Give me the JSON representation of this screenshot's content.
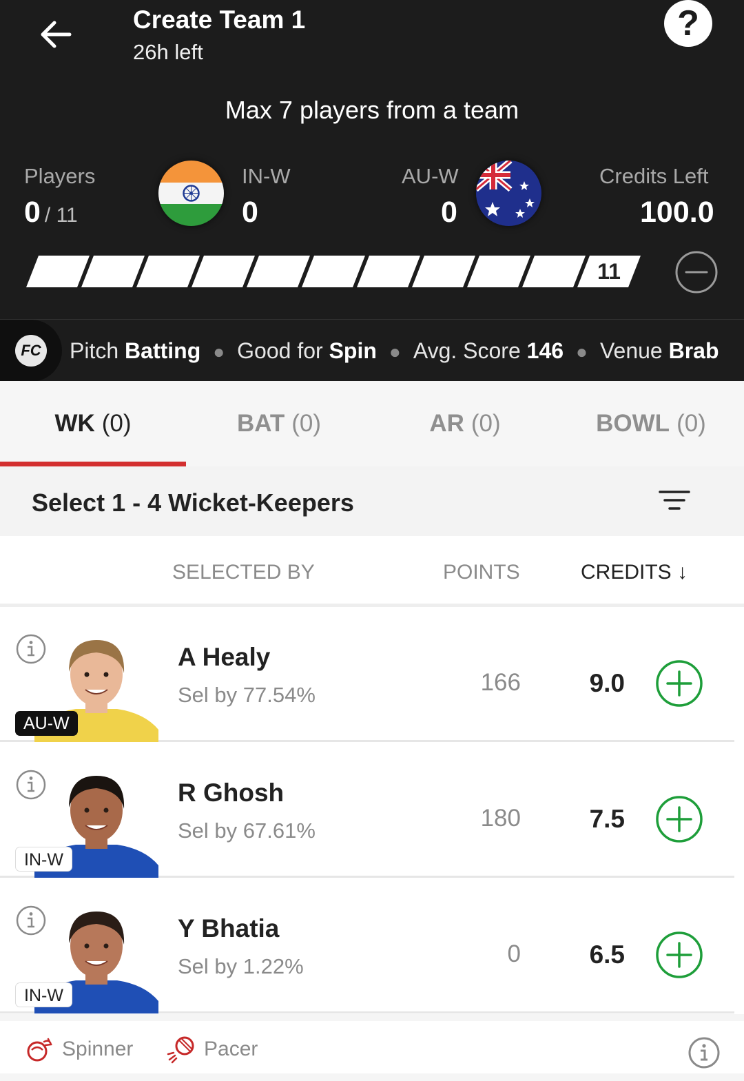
{
  "header": {
    "title": "Create Team 1",
    "time_left": "26h left",
    "help_label": "?",
    "max_note": "Max 7 players from a team"
  },
  "stats": {
    "players_label": "Players",
    "players_selected": "0",
    "players_total": "/ 11",
    "team1": {
      "code": "IN-W",
      "count": "0",
      "flag": "india-flag"
    },
    "team2": {
      "code": "AU-W",
      "count": "0",
      "flag": "australia-flag"
    },
    "credits_label": "Credits Left",
    "credits_value": "100.0"
  },
  "progress": {
    "filled": 0,
    "total_label": "11"
  },
  "pitch": {
    "logo": "FC",
    "items": [
      {
        "label": "Pitch",
        "value": "Batting"
      },
      {
        "label": "Good for",
        "value": "Spin"
      },
      {
        "label": "Avg. Score",
        "value": "146"
      },
      {
        "label": "Venue",
        "value": "Brab"
      }
    ]
  },
  "tabs": [
    {
      "label": "WK",
      "count": "(0)",
      "active": true
    },
    {
      "label": "BAT",
      "count": "(0)",
      "active": false
    },
    {
      "label": "AR",
      "count": "(0)",
      "active": false
    },
    {
      "label": "BOWL",
      "count": "(0)",
      "active": false
    }
  ],
  "select_note": "Select 1 - 4 Wicket-Keepers",
  "columns": {
    "selected_by": "SELECTED BY",
    "points": "POINTS",
    "credits": "CREDITS ↓"
  },
  "players": [
    {
      "name": "A Healy",
      "sel": "Sel by 77.54%",
      "points": "166",
      "credits": "9.0",
      "team": "AU-W",
      "jersey": "#f0d24a",
      "skin": "#e9b898",
      "hair": "#9a7446"
    },
    {
      "name": "R Ghosh",
      "sel": "Sel by 67.61%",
      "points": "180",
      "credits": "7.5",
      "team": "IN-W",
      "jersey": "#1f4fb5",
      "skin": "#a8694a",
      "hair": "#1a1410"
    },
    {
      "name": "Y Bhatia",
      "sel": "Sel by 1.22%",
      "points": "0",
      "credits": "6.5",
      "team": "IN-W",
      "jersey": "#1f4fb5",
      "skin": "#b7785a",
      "hair": "#2a1d16"
    }
  ],
  "footer": {
    "spinner_label": "Spinner",
    "pacer_label": "Pacer"
  },
  "colors": {
    "header_bg": "#1c1c1c",
    "accent_red": "#d32f2f",
    "add_green": "#1e9e3a"
  }
}
